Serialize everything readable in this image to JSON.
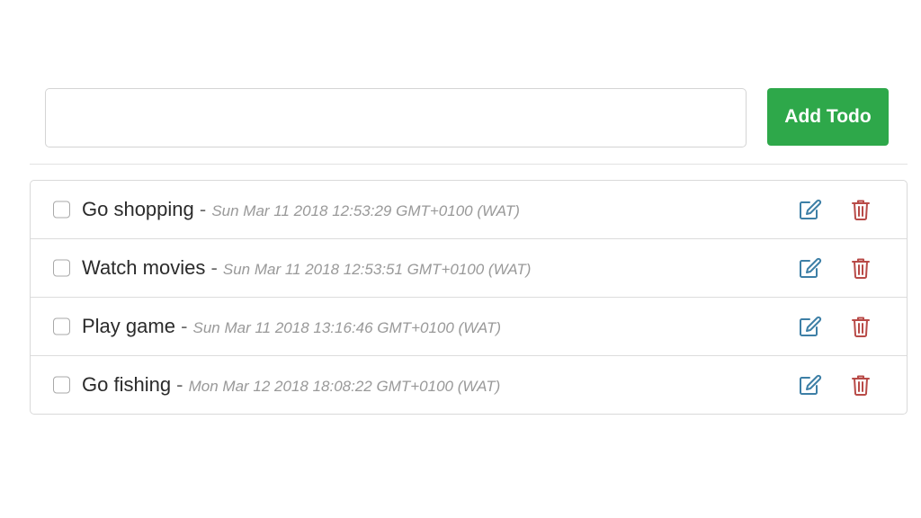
{
  "form": {
    "input_value": "",
    "input_placeholder": "",
    "add_button_label": "Add Todo"
  },
  "colors": {
    "add_button": "#2ea84a",
    "edit_icon": "#3d7fa6",
    "delete_icon": "#b84a47"
  },
  "icons": {
    "edit": "edit-icon",
    "delete": "trash-icon"
  },
  "todos": [
    {
      "title": "Go shopping",
      "separator": " - ",
      "date": "Sun Mar 11 2018 12:53:29 GMT+0100 (WAT)",
      "completed": false
    },
    {
      "title": "Watch movies",
      "separator": " - ",
      "date": "Sun Mar 11 2018 12:53:51 GMT+0100 (WAT)",
      "completed": false
    },
    {
      "title": "Play game",
      "separator": " - ",
      "date": "Sun Mar 11 2018 13:16:46 GMT+0100 (WAT)",
      "completed": false
    },
    {
      "title": "Go fishing",
      "separator": " - ",
      "date": "Mon Mar 12 2018 18:08:22 GMT+0100 (WAT)",
      "completed": false
    }
  ]
}
